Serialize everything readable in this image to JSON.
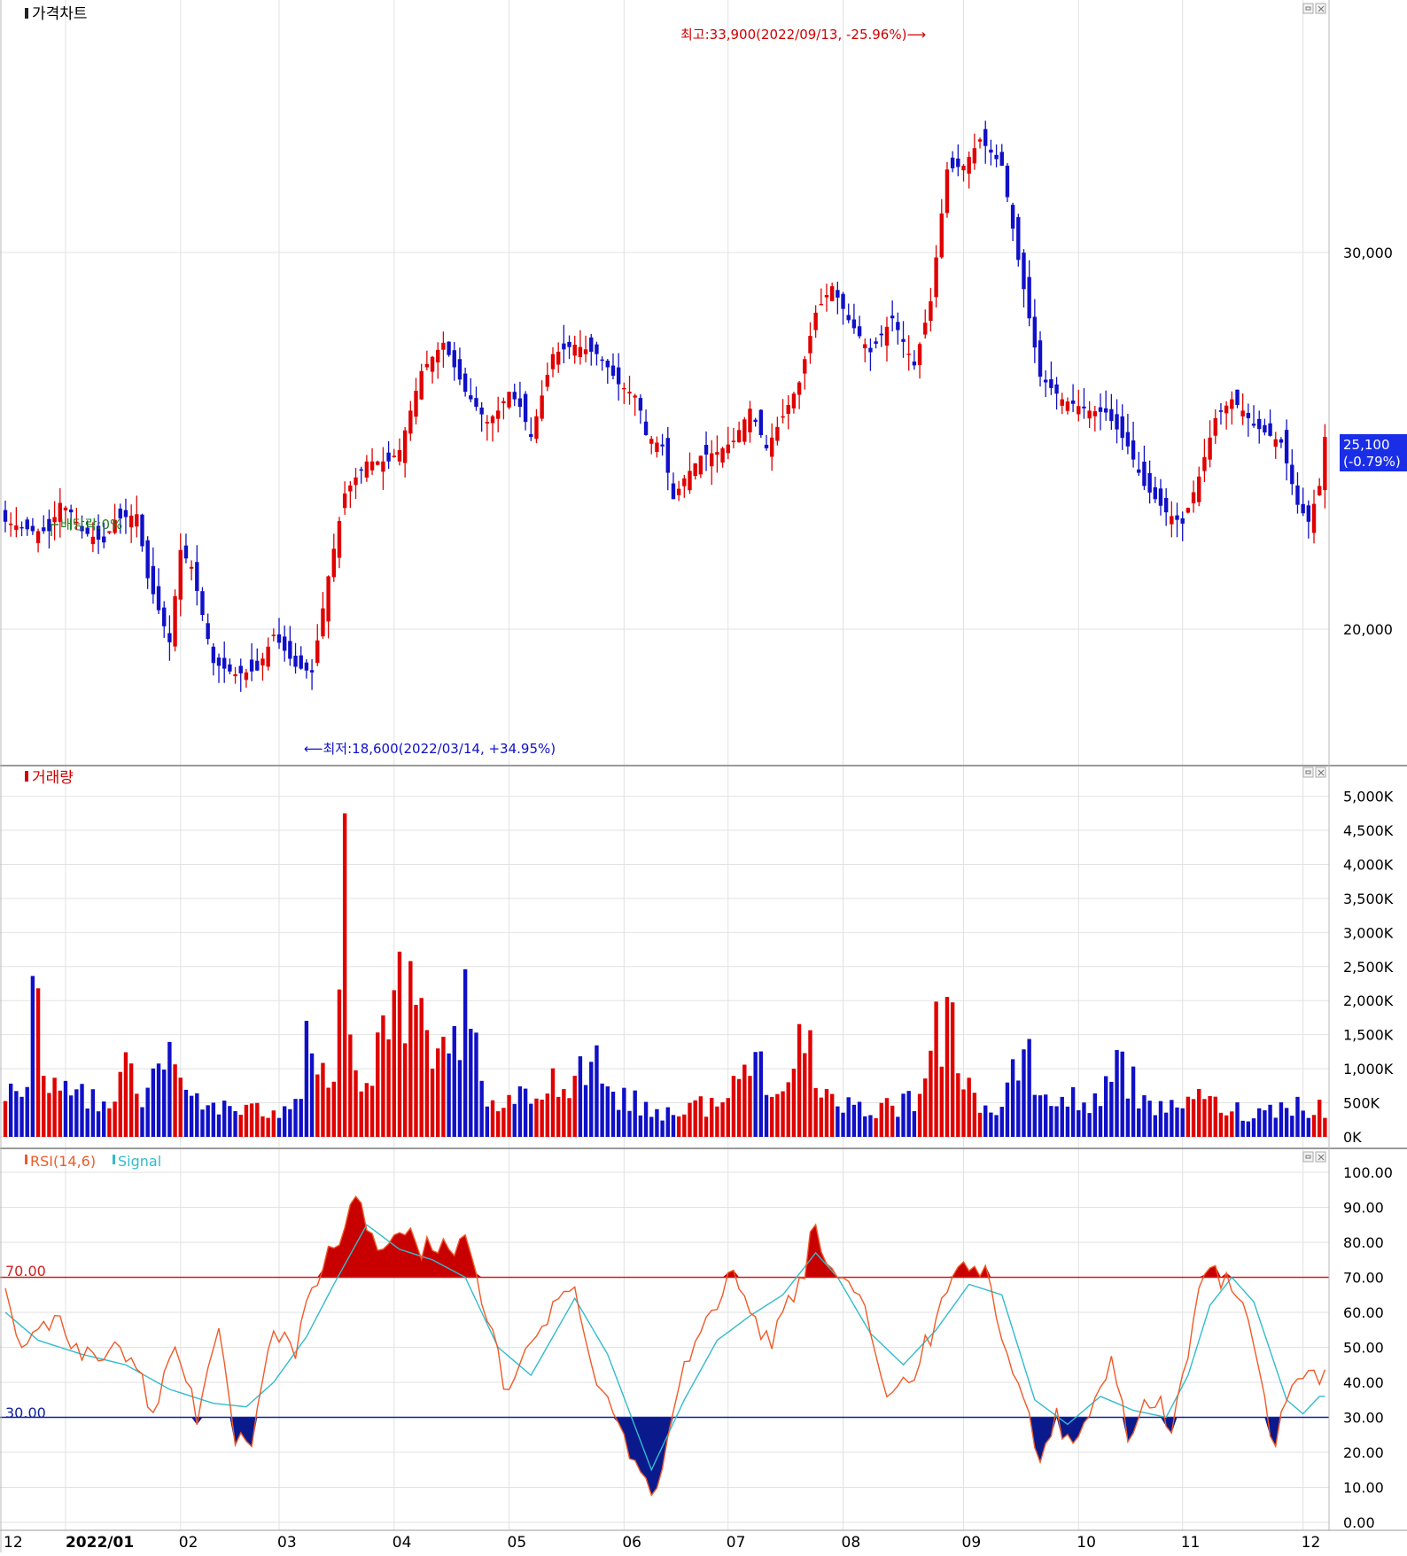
{
  "colors": {
    "up": "#e00000",
    "down": "#1010c8",
    "grid": "#e2e2e2",
    "rsi": "#f05a28",
    "signal": "#33bbcc",
    "line70": "#d02020",
    "line30": "#1020a0",
    "highlight": "#1a2ee8"
  },
  "panels": {
    "price": {
      "title": "가격차트"
    },
    "volume": {
      "title": "거래량"
    },
    "rsi": {
      "title": "RSI(14,6)",
      "signal_label": "Signal"
    }
  },
  "price": {
    "axis_ticks": [
      {
        "value": 30000,
        "label": "30,000"
      },
      {
        "value": 20000,
        "label": "20,000"
      }
    ],
    "ylim": [
      16400,
      36700
    ],
    "current": {
      "value": 25100,
      "label": "25,100",
      "change": "(-0.79%)"
    },
    "high_annotation": "최고:33,900(2022/09/13, -25.96%)⟶",
    "low_annotation": "⟵최저:18,600(2022/03/14, +34.95%)",
    "dividend": "배당락:0%"
  },
  "volume": {
    "axis_ticks": [
      {
        "value": 5000,
        "label": "5,000K"
      },
      {
        "value": 4500,
        "label": "4,500K"
      },
      {
        "value": 4000,
        "label": "4,000K"
      },
      {
        "value": 3500,
        "label": "3,500K"
      },
      {
        "value": 3000,
        "label": "3,000K"
      },
      {
        "value": 2500,
        "label": "2,500K"
      },
      {
        "value": 2000,
        "label": "2,000K"
      },
      {
        "value": 1500,
        "label": "1,500K"
      },
      {
        "value": 1000,
        "label": "1,000K"
      },
      {
        "value": 500,
        "label": "500K"
      },
      {
        "value": 0,
        "label": "0K"
      }
    ],
    "ylim": [
      0,
      5450
    ]
  },
  "rsi": {
    "axis_ticks": [
      {
        "value": 100,
        "label": "100.00"
      },
      {
        "value": 90,
        "label": "90.00"
      },
      {
        "value": 80,
        "label": "80.00"
      },
      {
        "value": 70,
        "label": "70.00"
      },
      {
        "value": 60,
        "label": "60.00"
      },
      {
        "value": 50,
        "label": "50.00"
      },
      {
        "value": 40,
        "label": "40.00"
      },
      {
        "value": 30,
        "label": "30.00"
      },
      {
        "value": 20,
        "label": "20.00"
      },
      {
        "value": 10,
        "label": "10.00"
      },
      {
        "value": 0,
        "label": "0.00"
      }
    ],
    "upper": {
      "value": 70,
      "label": "70.00"
    },
    "lower": {
      "value": 30,
      "label": "30.00"
    }
  },
  "x_axis": {
    "labels": [
      {
        "text": "12",
        "i": 0
      },
      {
        "text": "2022/01",
        "i": 11
      },
      {
        "text": "02",
        "i": 32
      },
      {
        "text": "03",
        "i": 50
      },
      {
        "text": "04",
        "i": 71
      },
      {
        "text": "05",
        "i": 92
      },
      {
        "text": "06",
        "i": 113
      },
      {
        "text": "07",
        "i": 132
      },
      {
        "text": "08",
        "i": 153
      },
      {
        "text": "09",
        "i": 175
      },
      {
        "text": "10",
        "i": 196
      },
      {
        "text": "11",
        "i": 215
      },
      {
        "text": "12",
        "i": 237
      }
    ]
  },
  "chart_data": {
    "type": "candlestick",
    "title": "",
    "xlabel": "",
    "ylabel": "",
    "anchors": [
      [
        0,
        22850
      ],
      [
        5,
        22600
      ],
      [
        8,
        22600
      ],
      [
        10,
        23350
      ],
      [
        12,
        23100
      ],
      [
        14,
        22600
      ],
      [
        18,
        22300
      ],
      [
        20,
        22900
      ],
      [
        24,
        23050
      ],
      [
        26,
        21350
      ],
      [
        30,
        19650
      ],
      [
        32,
        22100
      ],
      [
        34,
        21650
      ],
      [
        38,
        19100
      ],
      [
        42,
        18800
      ],
      [
        46,
        18900
      ],
      [
        49,
        19850
      ],
      [
        53,
        19000
      ],
      [
        56,
        18850
      ],
      [
        59,
        21400
      ],
      [
        62,
        23600
      ],
      [
        66,
        24450
      ],
      [
        70,
        24450
      ],
      [
        72,
        24750
      ],
      [
        76,
        26850
      ],
      [
        80,
        27600
      ],
      [
        84,
        26300
      ],
      [
        88,
        25500
      ],
      [
        90,
        25800
      ],
      [
        92,
        26300
      ],
      [
        94,
        25900
      ],
      [
        96,
        25100
      ],
      [
        98,
        26200
      ],
      [
        100,
        27300
      ],
      [
        104,
        27550
      ],
      [
        108,
        27300
      ],
      [
        110,
        26950
      ],
      [
        112,
        26500
      ],
      [
        115,
        26200
      ],
      [
        116,
        25800
      ],
      [
        117,
        25150
      ],
      [
        120,
        24850
      ],
      [
        122,
        23450
      ],
      [
        124,
        24000
      ],
      [
        127,
        24600
      ],
      [
        130,
        24700
      ],
      [
        133,
        25000
      ],
      [
        136,
        25850
      ],
      [
        139,
        24800
      ],
      [
        142,
        25650
      ],
      [
        145,
        26550
      ],
      [
        148,
        28400
      ],
      [
        151,
        29100
      ],
      [
        154,
        28200
      ],
      [
        158,
        27350
      ],
      [
        162,
        28250
      ],
      [
        166,
        27000
      ],
      [
        169,
        28700
      ],
      [
        172,
        32200
      ],
      [
        175,
        32300
      ],
      [
        178,
        33000
      ],
      [
        182,
        32300
      ],
      [
        185,
        29800
      ],
      [
        189,
        26700
      ],
      [
        193,
        26100
      ],
      [
        198,
        25800
      ],
      [
        201,
        25750
      ],
      [
        205,
        24850
      ],
      [
        208,
        23800
      ],
      [
        212,
        23100
      ],
      [
        215,
        22800
      ],
      [
        218,
        24050
      ],
      [
        221,
        25600
      ],
      [
        224,
        26100
      ],
      [
        226,
        25800
      ],
      [
        228,
        25400
      ],
      [
        233,
        24950
      ],
      [
        236,
        23300
      ],
      [
        238,
        22850
      ],
      [
        240,
        23800
      ],
      [
        241,
        25100
      ]
    ],
    "volume_anchors": [
      [
        0,
        700
      ],
      [
        4,
        600
      ],
      [
        5,
        2200
      ],
      [
        8,
        850
      ],
      [
        14,
        700
      ],
      [
        20,
        650
      ],
      [
        22,
        1600
      ],
      [
        24,
        700
      ],
      [
        28,
        900
      ],
      [
        29,
        1300
      ],
      [
        31,
        1100
      ],
      [
        33,
        750
      ],
      [
        38,
        500
      ],
      [
        44,
        400
      ],
      [
        50,
        450
      ],
      [
        54,
        850
      ],
      [
        55,
        2100
      ],
      [
        57,
        1200
      ],
      [
        60,
        1000
      ],
      [
        61,
        2400
      ],
      [
        62,
        4700
      ],
      [
        63,
        1500
      ],
      [
        66,
        650
      ],
      [
        72,
        2450
      ],
      [
        76,
        1700
      ],
      [
        78,
        1000
      ],
      [
        84,
        2000
      ],
      [
        88,
        450
      ],
      [
        96,
        650
      ],
      [
        108,
        1300
      ],
      [
        110,
        800
      ],
      [
        118,
        400
      ],
      [
        124,
        450
      ],
      [
        132,
        600
      ],
      [
        136,
        1300
      ],
      [
        140,
        1000
      ],
      [
        144,
        1000
      ],
      [
        146,
        2000
      ],
      [
        148,
        600
      ],
      [
        156,
        450
      ],
      [
        166,
        550
      ],
      [
        169,
        1900
      ],
      [
        173,
        1700
      ],
      [
        176,
        900
      ],
      [
        178,
        500
      ],
      [
        182,
        400
      ],
      [
        186,
        1450
      ],
      [
        188,
        900
      ],
      [
        190,
        600
      ],
      [
        196,
        600
      ],
      [
        200,
        500
      ],
      [
        203,
        1700
      ],
      [
        205,
        1000
      ],
      [
        208,
        500
      ],
      [
        212,
        400
      ],
      [
        216,
        700
      ],
      [
        218,
        600
      ],
      [
        222,
        500
      ],
      [
        226,
        400
      ],
      [
        230,
        400
      ],
      [
        234,
        550
      ],
      [
        238,
        500
      ],
      [
        241,
        450
      ]
    ],
    "rsi_anchors": [
      [
        0,
        65
      ],
      [
        3,
        51
      ],
      [
        6,
        54
      ],
      [
        9,
        59
      ],
      [
        13,
        50
      ],
      [
        16,
        46
      ],
      [
        20,
        53
      ],
      [
        24,
        44
      ],
      [
        27,
        30
      ],
      [
        31,
        53
      ],
      [
        35,
        31
      ],
      [
        39,
        52
      ],
      [
        42,
        24
      ],
      [
        45,
        22
      ],
      [
        49,
        54
      ],
      [
        53,
        49
      ],
      [
        57,
        71
      ],
      [
        60,
        78
      ],
      [
        64,
        92
      ],
      [
        68,
        78
      ],
      [
        72,
        84
      ],
      [
        76,
        78
      ],
      [
        80,
        80
      ],
      [
        84,
        79
      ],
      [
        86,
        70
      ],
      [
        88,
        58
      ],
      [
        92,
        35
      ],
      [
        96,
        53
      ],
      [
        100,
        62
      ],
      [
        104,
        66
      ],
      [
        108,
        42
      ],
      [
        112,
        28
      ],
      [
        116,
        15
      ],
      [
        118,
        5
      ],
      [
        121,
        25
      ],
      [
        124,
        45
      ],
      [
        128,
        62
      ],
      [
        130,
        62
      ],
      [
        133,
        72
      ],
      [
        136,
        57
      ],
      [
        140,
        52
      ],
      [
        143,
        63
      ],
      [
        146,
        73
      ],
      [
        148,
        88
      ],
      [
        150,
        72
      ],
      [
        154,
        70
      ],
      [
        158,
        55
      ],
      [
        162,
        34
      ],
      [
        166,
        42
      ],
      [
        170,
        58
      ],
      [
        174,
        70
      ],
      [
        177,
        75
      ],
      [
        179,
        70
      ],
      [
        183,
        48
      ],
      [
        187,
        29
      ],
      [
        189,
        20
      ],
      [
        192,
        31
      ],
      [
        194,
        23
      ],
      [
        198,
        30
      ],
      [
        200,
        40
      ],
      [
        202,
        47
      ],
      [
        205,
        24
      ],
      [
        208,
        34
      ],
      [
        211,
        33
      ],
      [
        213,
        28
      ],
      [
        216,
        47
      ],
      [
        218,
        67
      ],
      [
        220,
        72
      ],
      [
        223,
        69
      ],
      [
        226,
        60
      ],
      [
        228,
        52
      ],
      [
        230,
        34
      ],
      [
        232,
        22
      ],
      [
        234,
        35
      ],
      [
        236,
        42
      ]
    ],
    "signal_anchors": [
      [
        0,
        60
      ],
      [
        6,
        52
      ],
      [
        14,
        48
      ],
      [
        22,
        45
      ],
      [
        30,
        38
      ],
      [
        38,
        34
      ],
      [
        44,
        33
      ],
      [
        49,
        40
      ],
      [
        55,
        53
      ],
      [
        60,
        68
      ],
      [
        66,
        85
      ],
      [
        72,
        78
      ],
      [
        78,
        75
      ],
      [
        84,
        70
      ],
      [
        90,
        50
      ],
      [
        96,
        42
      ],
      [
        104,
        64
      ],
      [
        110,
        48
      ],
      [
        118,
        15
      ],
      [
        124,
        35
      ],
      [
        130,
        52
      ],
      [
        136,
        59
      ],
      [
        142,
        65
      ],
      [
        148,
        77
      ],
      [
        152,
        70
      ],
      [
        158,
        54
      ],
      [
        164,
        45
      ],
      [
        170,
        55
      ],
      [
        176,
        68
      ],
      [
        182,
        65
      ],
      [
        188,
        35
      ],
      [
        194,
        28
      ],
      [
        200,
        36
      ],
      [
        206,
        32
      ],
      [
        212,
        30
      ],
      [
        216,
        42
      ],
      [
        220,
        62
      ],
      [
        224,
        70
      ],
      [
        228,
        63
      ],
      [
        234,
        35
      ],
      [
        237,
        31
      ],
      [
        240,
        36
      ]
    ],
    "series": [
      {
        "name": "가격차트",
        "type": "candlestick"
      },
      {
        "name": "거래량",
        "type": "bar"
      },
      {
        "name": "RSI(14,6)",
        "type": "line"
      },
      {
        "name": "Signal",
        "type": "line"
      }
    ]
  }
}
